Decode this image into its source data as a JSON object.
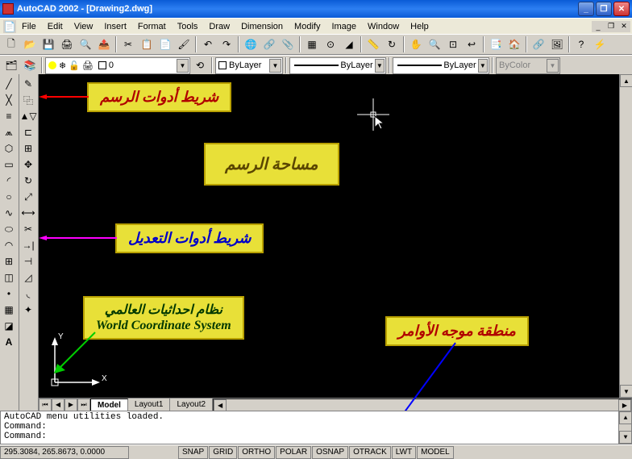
{
  "window": {
    "title": "AutoCAD 2002 - [Drawing2.dwg]"
  },
  "menu": [
    "File",
    "Edit",
    "View",
    "Insert",
    "Format",
    "Tools",
    "Draw",
    "Dimension",
    "Modify",
    "Image",
    "Window",
    "Help"
  ],
  "props": {
    "layer": "0",
    "color": "ByLayer",
    "linetype": "ByLayer",
    "lineweight": "ByLayer",
    "bycolor": "ByColor"
  },
  "tabs": {
    "model": "Model",
    "layout1": "Layout1",
    "layout2": "Layout2"
  },
  "command": {
    "line1": "AutoCAD menu utilities loaded.",
    "line2": "Command:",
    "line3": "Command:"
  },
  "status": {
    "coords": "295.3084, 265.8673, 0.0000",
    "snap": "SNAP",
    "grid": "GRID",
    "ortho": "ORTHO",
    "polar": "POLAR",
    "osnap": "OSNAP",
    "otrack": "OTRACK",
    "lwt": "LWT",
    "model": "MODEL"
  },
  "annotations": {
    "drawtools": "شريط أدوات الرسم",
    "drawarea": "مساحة الرسم",
    "modifytools": "شريط أدوات التعديل",
    "wcs_ar": "نظام احداثيات العالمي",
    "wcs_en": "World Coordinate System",
    "cmdarea": "منطقة موجه الأوامر"
  },
  "ucs": {
    "x": "X",
    "y": "Y"
  }
}
